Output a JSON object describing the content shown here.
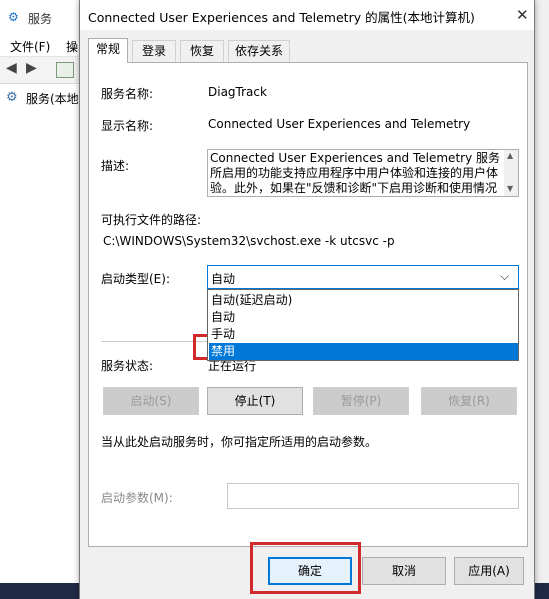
{
  "bg_window": {
    "title": "服务",
    "menu_file": "文件(F)",
    "menu_action": "操",
    "tree_item": "服务(本地"
  },
  "dialog": {
    "title": "Connected User Experiences and Telemetry 的属性(本地计算机)",
    "close_glyph": "✕",
    "tabs": [
      "常规",
      "登录",
      "恢复",
      "依存关系"
    ]
  },
  "general": {
    "service_name_label": "服务名称:",
    "service_name_value": "DiagTrack",
    "display_name_label": "显示名称:",
    "display_name_value": "Connected User Experiences and Telemetry",
    "description_label": "描述:",
    "description_lines": [
      "Connected User Experiences and Telemetry 服务",
      "所启用的功能支持应用程序中用户体验和连接的用户体",
      "验。此外，如果在\"反馈和诊断\"下启用诊断和使用情况"
    ],
    "exe_path_label": "可执行文件的路径:",
    "exe_path_value": "C:\\WINDOWS\\System32\\svchost.exe -k utcsvc -p",
    "startup_type_label": "启动类型(E):",
    "startup_type_value": "自动",
    "startup_options": [
      "自动(延迟启动)",
      "自动",
      "手动",
      "禁用"
    ],
    "startup_selected": "禁用",
    "status_label": "服务状态:",
    "status_value": "正在运行",
    "btn_start": "启动(S)",
    "btn_stop": "停止(T)",
    "btn_pause": "暂停(P)",
    "btn_resume": "恢复(R)",
    "hint": "当从此处启动服务时，你可指定所适用的启动参数。",
    "params_label": "启动参数(M):"
  },
  "footer": {
    "ok": "确定",
    "cancel": "取消",
    "apply": "应用(A)"
  },
  "colors": {
    "highlight": "#0078d7",
    "annotation": "#d22a2a"
  }
}
